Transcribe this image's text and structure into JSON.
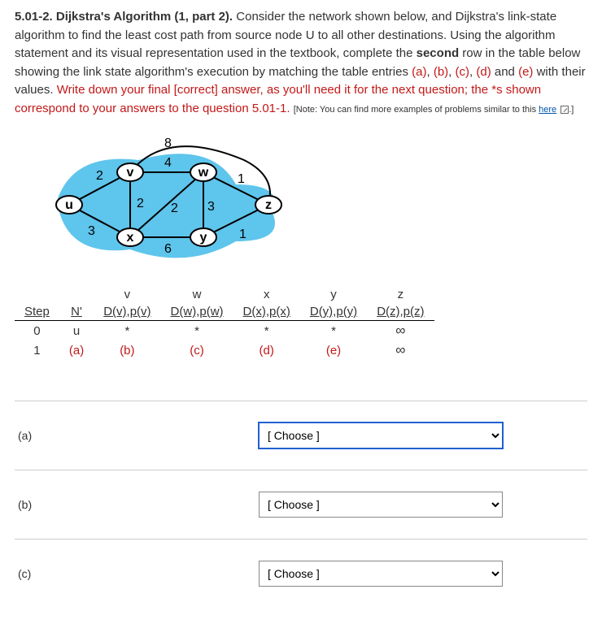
{
  "problem": {
    "number": "5.01-2.",
    "title_bold": "Dijkstra's Algorithm (1, part 2).",
    "body_1": "Consider the network shown below, and Dijkstra's link-state algorithm to find the least cost path from source node U to all other destinations.  Using the algorithm statement and its visual representation used in the textbook, complete the ",
    "body_bold_1": "second",
    "body_2": " row in the table below showing the link state algorithm's execution by matching the table entries ",
    "body_a": "(a)",
    "body_b": "(b)",
    "body_c": "(c)",
    "body_d": "(d)",
    "body_e": "(e)",
    "body_and": " and ",
    "body_with": " with their values.  ",
    "red_text": "Write down your final [correct] answer, as you'll need it for the next question; the *s shown correspond to your answers to the question 5.01-1.",
    "note_prefix": "[Note: You can find more examples of problems similar to this ",
    "note_link": "here",
    "note_suffix": ".]"
  },
  "graph": {
    "nodes": [
      "u",
      "v",
      "w",
      "z",
      "y",
      "x"
    ],
    "edge_labels": {
      "uv": "2",
      "ux": "3",
      "vx": "2",
      "vw": "4",
      "wx": "2",
      "wy": "3",
      "xy": "6",
      "yz": "1",
      "wz": "1",
      "top": "8"
    }
  },
  "table": {
    "headers_top": [
      "",
      "",
      "v",
      "w",
      "x",
      "y",
      "z"
    ],
    "headers": [
      "Step",
      "N'",
      "D(v),p(v)",
      "D(w),p(w)",
      "D(x),p(x)",
      "D(y),p(y)",
      "D(z),p(z)"
    ],
    "row0": [
      "0",
      "u",
      "*",
      "*",
      "*",
      "*",
      "∞"
    ],
    "row1": [
      "1",
      "(a)",
      "(b)",
      "(c)",
      "(d)",
      "(e)",
      "∞"
    ]
  },
  "answers": {
    "a_label": "(a)",
    "b_label": "(b)",
    "c_label": "(c)",
    "placeholder": "[ Choose ]"
  }
}
